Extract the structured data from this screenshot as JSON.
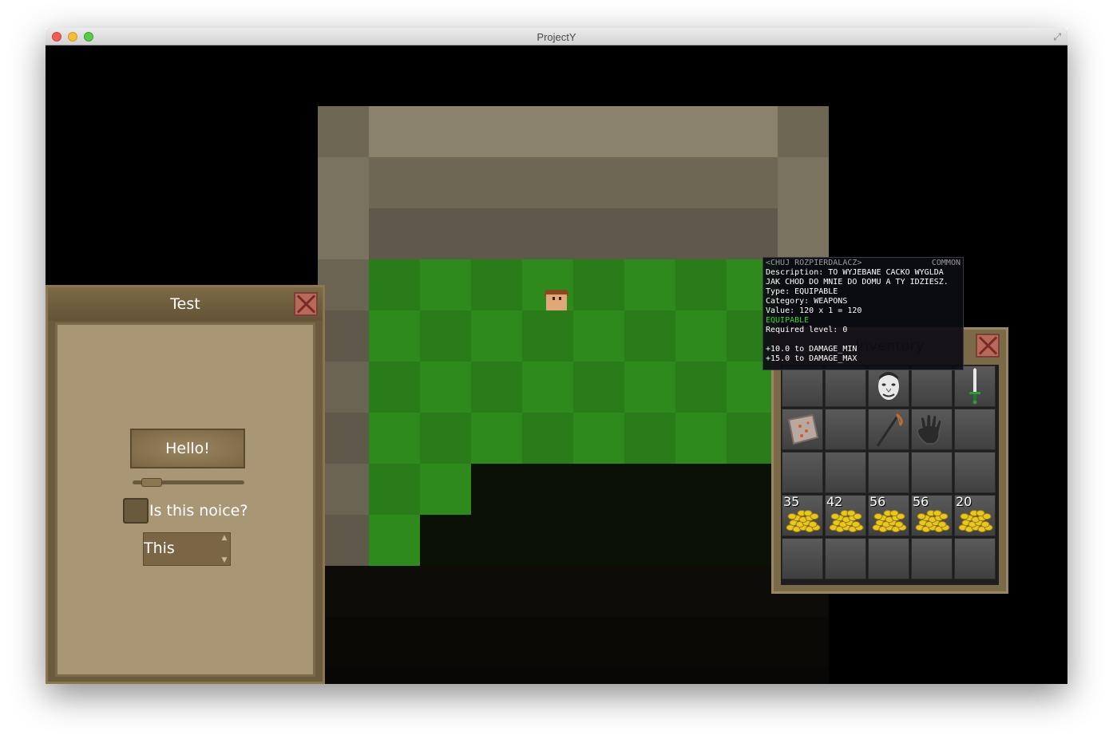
{
  "window": {
    "title": "ProjectY"
  },
  "panel": {
    "title": "Test",
    "button_label": "Hello!",
    "slider_value": 0.1,
    "checkbox_label": "Is this noice?",
    "checkbox_checked": false,
    "spinner_value": "This"
  },
  "inventory": {
    "title": "Inventory",
    "slots": [
      [
        {
          "item": ""
        },
        {
          "item": ""
        },
        {
          "item": "face-portrait"
        },
        {
          "item": ""
        },
        {
          "item": "sword"
        }
      ],
      [
        {
          "item": "cloth"
        },
        {
          "item": ""
        },
        {
          "item": "bow"
        },
        {
          "item": "glove"
        },
        {
          "item": ""
        }
      ],
      [
        {
          "item": ""
        },
        {
          "item": ""
        },
        {
          "item": ""
        },
        {
          "item": ""
        },
        {
          "item": ""
        }
      ],
      [
        {
          "item": "gold",
          "count": "35"
        },
        {
          "item": "gold",
          "count": "42"
        },
        {
          "item": "gold",
          "count": "56"
        },
        {
          "item": "gold",
          "count": "56"
        },
        {
          "item": "gold",
          "count": "20"
        }
      ],
      [
        {
          "item": ""
        },
        {
          "item": ""
        },
        {
          "item": ""
        },
        {
          "item": ""
        },
        {
          "item": ""
        }
      ]
    ]
  },
  "tooltip": {
    "name": "<CHUJ ROZPIERDALACZ>",
    "rarity": "COMMON",
    "lines": [
      "Description:  TO WYJEBANE CACKO WYGLDA",
      "JAK CHOD DO MNIE DO DOMU A TY IDZIESZ.",
      "Type:  EQUIPABLE",
      "Category:  WEAPONS",
      "Value: 120 x 1 = 120"
    ],
    "equipable": "EQUIPABLE",
    "required_level": "Required level: 0",
    "stats": [
      "+10.0 to DAMAGE_MIN",
      "+15.0 to DAMAGE_MAX"
    ]
  },
  "colors": {
    "stone_light": "#b0a68c",
    "stone": "#8a826a",
    "stone_dark": "#5e594a",
    "grass": "#2f8a1e",
    "grass_dark": "#2a7c1a",
    "gold": "#e8c820"
  },
  "icons": {
    "close": "close-icon",
    "fullscreen": "fullscreen-icon"
  }
}
